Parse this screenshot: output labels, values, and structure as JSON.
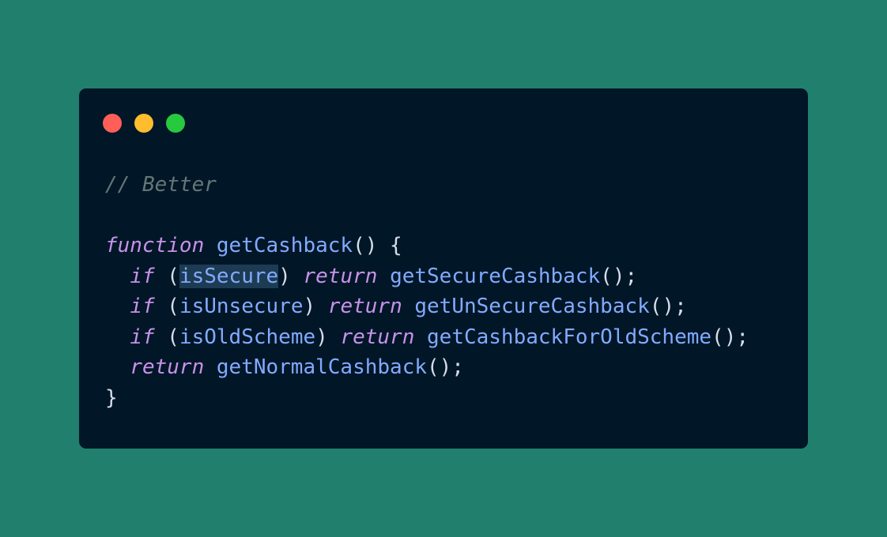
{
  "colors": {
    "background": "#20806d",
    "window": "#011627",
    "dot_red": "#ff5f56",
    "dot_yellow": "#ffbd2e",
    "dot_green": "#27c93f",
    "comment": "#637777",
    "keyword": "#c792ea",
    "function": "#82aaff",
    "punctuation": "#d6deeb",
    "selection": "#1d3b53"
  },
  "code": {
    "comment": "// Better",
    "l1": {
      "kw": "function",
      "name": "getCashback",
      "rest": "() {"
    },
    "l2": {
      "indent": "  ",
      "kw": "if",
      "open": " (",
      "cond": "isSecure",
      "close": ") ",
      "ret": "return",
      "sp": " ",
      "call": "getSecureCashback",
      "end": "();"
    },
    "l3": {
      "indent": "  ",
      "kw": "if",
      "open": " (",
      "cond": "isUnsecure",
      "close": ") ",
      "ret": "return",
      "sp": " ",
      "call": "getUnSecureCashback",
      "end": "();"
    },
    "l4": {
      "indent": "  ",
      "kw": "if",
      "open": " (",
      "cond": "isOldScheme",
      "close": ") ",
      "ret": "return",
      "sp": " ",
      "call": "getCashbackForOldScheme",
      "end": "();"
    },
    "l5": {
      "indent": "  ",
      "ret": "return",
      "sp": " ",
      "call": "getNormalCashback",
      "end": "();"
    },
    "close": "}"
  }
}
